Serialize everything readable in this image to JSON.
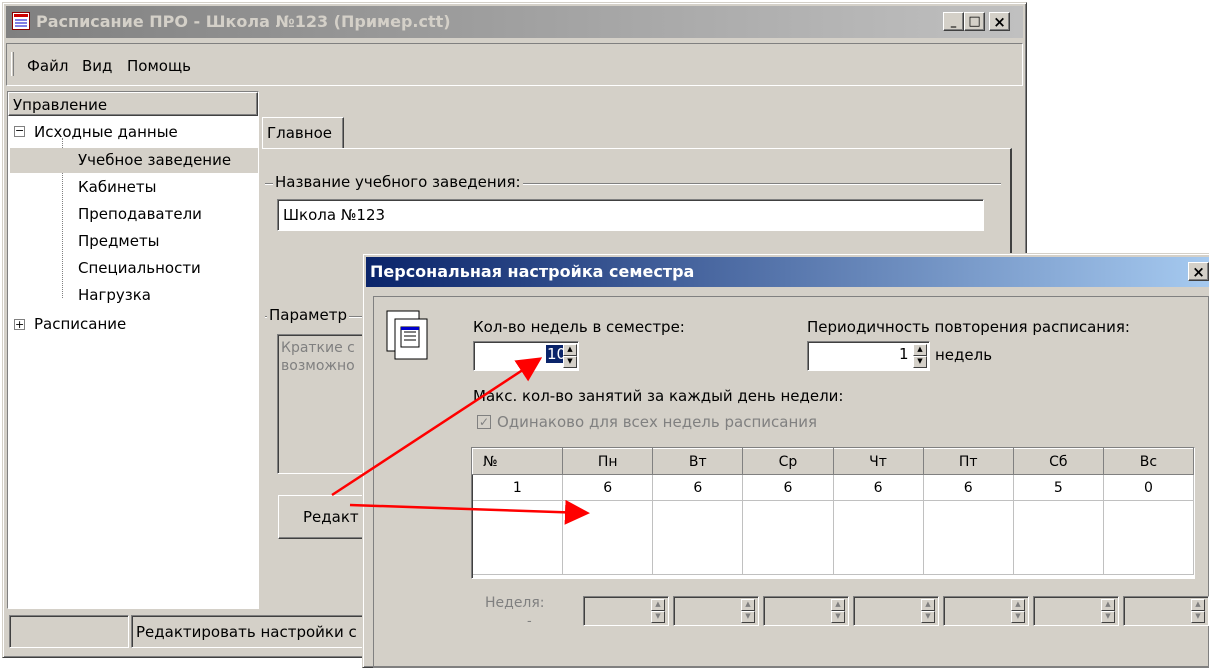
{
  "main_window": {
    "title": "Расписание ПРО - Школа №123 (Пример.ctt)",
    "min": "_",
    "max": "□",
    "close": "×",
    "menu": [
      "Файл",
      "Вид",
      "Помощь"
    ],
    "tree_header": "Управление",
    "tree": {
      "root1": "Исходные данные",
      "children": [
        "Учебное заведение",
        "Кабинеты",
        "Преподаватели",
        "Предметы",
        "Специальности",
        "Нагрузка"
      ],
      "root2": "Расписание"
    },
    "tab": "Главное",
    "name_label": "Название учебного заведения:",
    "name_value": "Школа №123",
    "params_label": "Параметр",
    "desc_line1": "Краткие с",
    "desc_line2": "возможно",
    "edit_button": "Редакт",
    "status_text": "Редактировать настройки с"
  },
  "dialog": {
    "title": "Персональная настройка семестра",
    "close": "×",
    "weeks_label": "Кол-во недель в семестре:",
    "weeks_value": "10",
    "period_label": "Периодичность повторения расписания:",
    "period_value": "1",
    "period_unit": "недель",
    "max_label": "Макс. кол-во занятий за каждый день недели:",
    "same_checkbox": "Одинаково для всех недель расписания",
    "same_checked": true,
    "columns": [
      "№",
      "Пн",
      "Вт",
      "Ср",
      "Чт",
      "Пт",
      "Сб",
      "Вс"
    ],
    "row": [
      "1",
      "6",
      "6",
      "6",
      "6",
      "6",
      "5",
      "0"
    ],
    "week_label": "Неделя:",
    "week_dash": "-"
  },
  "colors": {
    "face": "#d4d0c8",
    "main_title_grad": [
      "#808080",
      "#c0c0c0"
    ],
    "dialog_title_grad": [
      "#0a246a",
      "#a6caf0"
    ],
    "arrow": "#ff0000"
  }
}
